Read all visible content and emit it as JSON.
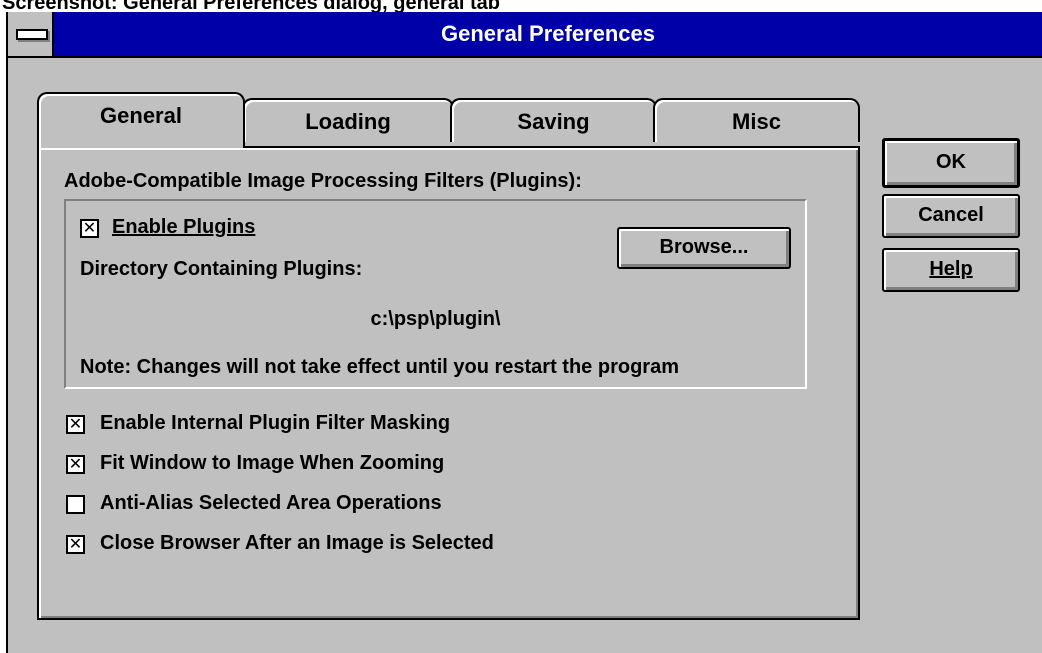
{
  "background_caption": "Screenshot: General Preferences dialog, general tab",
  "window": {
    "title": "General Preferences"
  },
  "tabs": [
    {
      "label": "General",
      "active": true
    },
    {
      "label": "Loading",
      "active": false
    },
    {
      "label": "Saving",
      "active": false
    },
    {
      "label": "Misc",
      "active": false
    }
  ],
  "general": {
    "plugins_heading": "Adobe-Compatible Image Processing Filters (Plugins):",
    "enable_plugins": {
      "label": "Enable Plugins",
      "checked": true
    },
    "browse_label": "Browse...",
    "directory_label": "Directory Containing Plugins:",
    "directory_value": "c:\\psp\\plugin\\",
    "note": "Note: Changes will not take effect until you restart the program",
    "options": [
      {
        "label": "Enable Internal Plugin Filter Masking",
        "checked": true
      },
      {
        "label": "Fit Window to Image When Zooming",
        "checked": true
      },
      {
        "label": "Anti-Alias Selected Area Operations",
        "checked": false
      },
      {
        "label": "Close Browser After an Image is Selected",
        "checked": true
      }
    ]
  },
  "buttons": {
    "ok": "OK",
    "cancel": "Cancel",
    "help": "Help"
  },
  "colors": {
    "title_bar": "#0000a8",
    "face": "#c0c0c0",
    "shadow": "#808080"
  }
}
